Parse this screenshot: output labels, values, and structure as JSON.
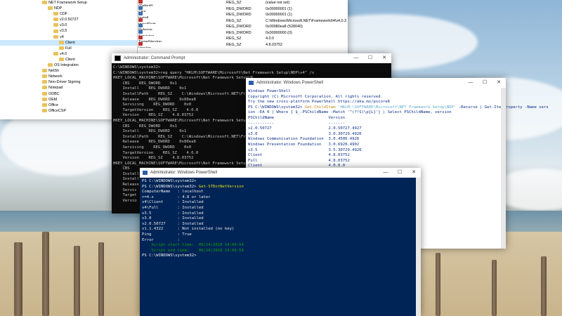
{
  "regedit": {
    "tree": [
      {
        "label": "NET Framework Setup",
        "indent": 60
      },
      {
        "label": "NDP",
        "indent": 68
      },
      {
        "label": "CDF",
        "indent": 76
      },
      {
        "label": "v2.0.50727",
        "indent": 76
      },
      {
        "label": "v3.0",
        "indent": 76
      },
      {
        "label": "v3.5",
        "indent": 76
      },
      {
        "label": "v4",
        "indent": 76
      },
      {
        "label": "Client",
        "indent": 84,
        "selected": true
      },
      {
        "label": "Full",
        "indent": 84
      },
      {
        "label": "v4.0",
        "indent": 76
      },
      {
        "label": "Client",
        "indent": 84
      },
      {
        "label": "OS Integration",
        "indent": 68
      },
      {
        "label": "NetSh",
        "indent": 60
      },
      {
        "label": "Network",
        "indent": 60
      },
      {
        "label": "Non-Driver Signing",
        "indent": 60
      },
      {
        "label": "Notepad",
        "indent": 60
      },
      {
        "label": "ODBC",
        "indent": 60
      },
      {
        "label": "OEM",
        "indent": 60
      },
      {
        "label": "Office",
        "indent": 60
      },
      {
        "label": "OfficeCSP",
        "indent": 60
      }
    ],
    "values": [
      {
        "name": "(Default)",
        "type": "REG_SZ",
        "data": "(value not set)",
        "kind": "sz"
      },
      {
        "name": "CBS",
        "type": "REG_DWORD",
        "data": "0x00000001 (1)",
        "kind": "dw"
      },
      {
        "name": "Install",
        "type": "REG_DWORD",
        "data": "0x00000001 (1)",
        "kind": "dw"
      },
      {
        "name": "InstallPath",
        "type": "REG_SZ",
        "data": "C:\\Windows\\Microsoft.NET\\Framework64\\v4.0.3",
        "kind": "sz"
      },
      {
        "name": "Release",
        "type": "REG_DWORD",
        "data": "0x00080ea8 (528040)",
        "kind": "dw"
      },
      {
        "name": "Servicing",
        "type": "REG_DWORD",
        "data": "0x00000000 (0)",
        "kind": "dw"
      },
      {
        "name": "TargetVersion",
        "type": "REG_SZ",
        "data": "4.0.0",
        "kind": "sz"
      },
      {
        "name": "Version",
        "type": "REG_SZ",
        "data": "4.8.03752",
        "kind": "sz"
      }
    ]
  },
  "cmd": {
    "title": "Administrator: Command Prompt",
    "lines": [
      "",
      "C:\\WINDOWS\\system32>",
      "C:\\WINDOWS\\system32>reg query \"HKLM\\SOFTWARE\\Microsoft\\Net Framework Setup\\NDP\\v4\" /s",
      "",
      "HKEY_LOCAL_MACHINE\\SOFTWARE\\Microsoft\\Net Framework Setup\\N",
      "    CBS    REG_DWORD    0x1",
      "    Install    REG_DWORD    0x1",
      "    InstallPath    REG_SZ    C:\\Windows\\Microsoft.NET\\Frame",
      "    Release    REG_DWORD    0x80ea8",
      "    Servicing    REG_DWORD    0x0",
      "    TargetVersion    REG_SZ    4.0.0",
      "    Version    REG_SZ    4.8.03752",
      "",
      "HKEY_LOCAL_MACHINE\\SOFTWARE\\Microsoft\\Net Framework Setup\\N",
      "    CBS    REG_DWORD    0x1",
      "    Install    REG_DWORD    0x1",
      "    InstallPath    REG_SZ    C:\\Windows\\Microsoft.NET\\Frame",
      "    Release    REG_DWORD    0x80ea8",
      "    Servicing    REG_DWORD    0x0",
      "    TargetVersion    REG_SZ    4.0.0",
      "    Version    REG_SZ    4.8.03752",
      "",
      "HKEY_LOCAL_MACHINE\\SOFTWARE\\Microsoft\\Net Framework Setup\\N",
      "    CBS",
      "    Install",
      "    Install",
      "    Release",
      "    Servic",
      "    Target",
      "    Versio"
    ]
  },
  "ps1": {
    "title": "Administrator: Windows PowerShell",
    "header": [
      "Windows PowerShell",
      "Copyright (C) Microsoft Corporation. All rights reserved.",
      "",
      "Try the new cross-platform PowerShell https://aka.ms/pscore6",
      ""
    ],
    "prompt": "PS C:\\WINDOWS\\system32> ",
    "cmd1": "Get-ChildItem",
    "arg1": " 'HKLM:\\SOFTWARE\\Microsoft\\NET Framework Setup\\NDP'",
    "cmd1b": " -Recurse | Get-ItemProperty -Name vers",
    "cmd2": "ion -EA 0 | Where { $_.PSChildName -Match '^(?!S)\\p{L}'} | Select PSChildName, version",
    "col1": "PSChildName",
    "col2": "Version",
    "dash1": "-----------",
    "dash2": "-------",
    "rows": [
      [
        "v2.0.50727",
        "2.0.50727.4927"
      ],
      [
        "v3.0",
        "3.0.30729.4926"
      ],
      [
        "Windows Communication Foundation",
        "3.0.4506.4926"
      ],
      [
        "Windows Presentation Foundation",
        "3.0.6920.4902"
      ],
      [
        "v3.5",
        "3.5.30729.4926"
      ],
      [
        "Client",
        "4.8.03752"
      ],
      [
        "Full",
        "4.8.03752"
      ],
      [
        "Client",
        "4.0.0.0"
      ]
    ]
  },
  "ps2": {
    "title": "Administrator: Windows PowerShell",
    "lines": [
      "PS C:\\WINDOWS\\system32>",
      "PS C:\\WINDOWS\\system32> "
    ],
    "cmd": "Get-STDotNetVersion",
    "results": [
      "",
      "ComputerName   : localhost",
      ">=4.x          : 4.8 or later",
      "v4\\Client      : Installed",
      "v4\\Full        : Installed",
      "v3.5           : Installed",
      "v3.0           : Installed",
      "v2.0.50727     : Installed",
      "v1.1.4322      : Not installed (no key)",
      "Ping           : True",
      "Error          : ",
      ""
    ],
    "start": "    Script start time:  06/24/2020 14:04:54",
    "end": "    Script end time:    06/24/2020 14:04:54",
    "final": "PS C:\\WINDOWS\\system32>"
  },
  "colors": {
    "ps_blue": "#012456",
    "cmd_black": "#0c0c0c",
    "ps_yellow": "#e5e510",
    "ps_green": "#13a10e"
  }
}
